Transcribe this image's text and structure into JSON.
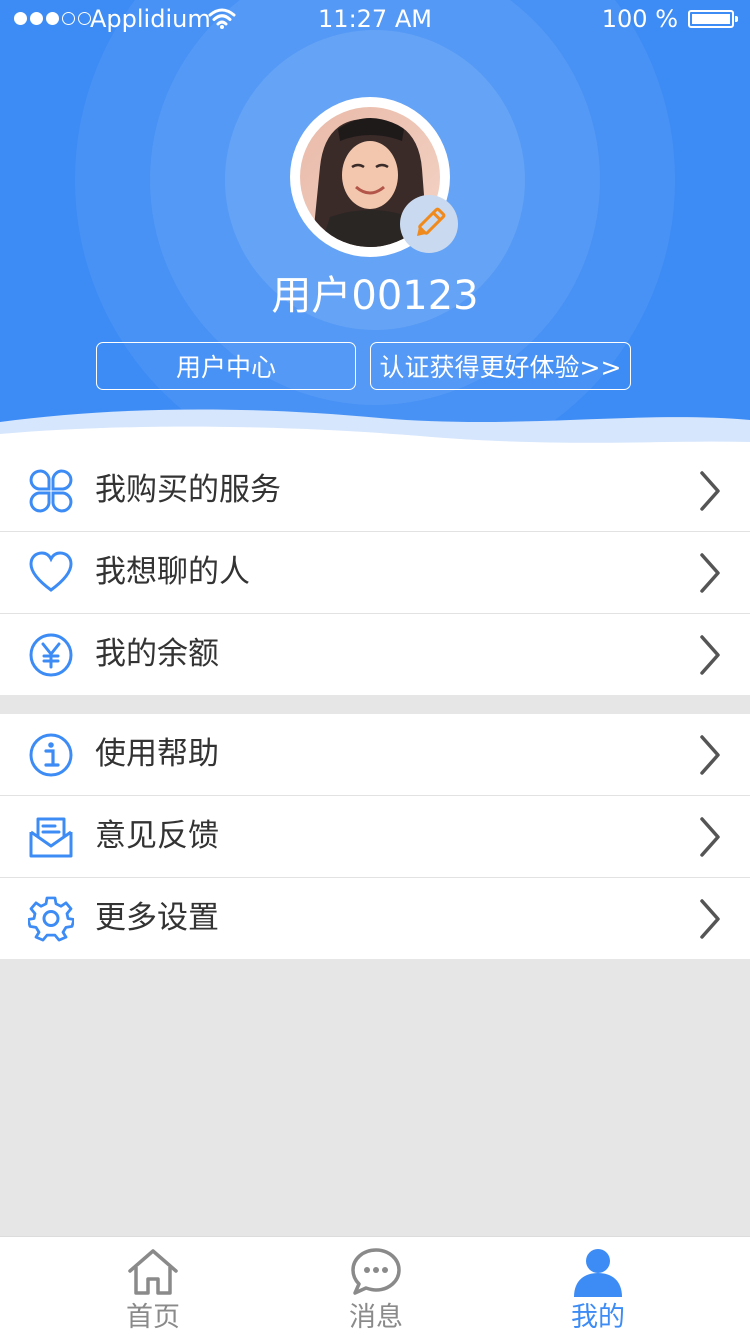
{
  "status_bar": {
    "carrier": "Applidium",
    "time": "11:27 AM",
    "battery": "100 %"
  },
  "profile": {
    "username": "用户00123",
    "user_center_label": "用户中心",
    "verify_label": "认证获得更好体验>>"
  },
  "menu_group_1": [
    {
      "label": "我购买的服务",
      "icon": "clover-grid-icon"
    },
    {
      "label": "我想聊的人",
      "icon": "heart-icon"
    },
    {
      "label": "我的余额",
      "icon": "yen-icon"
    }
  ],
  "menu_group_2": [
    {
      "label": "使用帮助",
      "icon": "info-icon"
    },
    {
      "label": "意见反馈",
      "icon": "mail-icon"
    },
    {
      "label": "更多设置",
      "icon": "gear-icon"
    }
  ],
  "tabbar": {
    "home": "首页",
    "messages": "消息",
    "mine": "我的",
    "active": "mine"
  },
  "colors": {
    "accent": "#3d8cf5",
    "edit_badge": "#f08a1c",
    "background": "#e6e6e6"
  }
}
